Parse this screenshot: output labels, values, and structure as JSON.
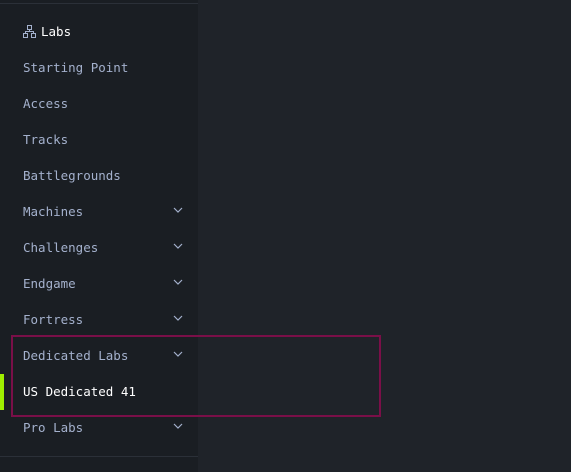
{
  "sidebar": {
    "header": {
      "label": "Labs",
      "icon": "labs-network-icon"
    },
    "items": [
      {
        "label": "Starting Point",
        "expandable": false
      },
      {
        "label": "Access",
        "expandable": false
      },
      {
        "label": "Tracks",
        "expandable": false
      },
      {
        "label": "Battlegrounds",
        "expandable": false
      },
      {
        "label": "Machines",
        "expandable": true
      },
      {
        "label": "Challenges",
        "expandable": true
      },
      {
        "label": "Endgame",
        "expandable": true
      },
      {
        "label": "Fortress",
        "expandable": true
      },
      {
        "label": "Dedicated Labs",
        "expandable": true,
        "expanded": true
      },
      {
        "label": "US Dedicated 41",
        "expandable": false,
        "active": true,
        "submenu": true
      },
      {
        "label": "Pro Labs",
        "expandable": true
      }
    ]
  },
  "colors": {
    "background": "#1f2329",
    "sidebar_background": "#1a1e23",
    "text": "#a4b1cd",
    "active_text": "#ffffff",
    "active_indicator": "#9fef00",
    "highlight_border": "#7a0f48"
  }
}
